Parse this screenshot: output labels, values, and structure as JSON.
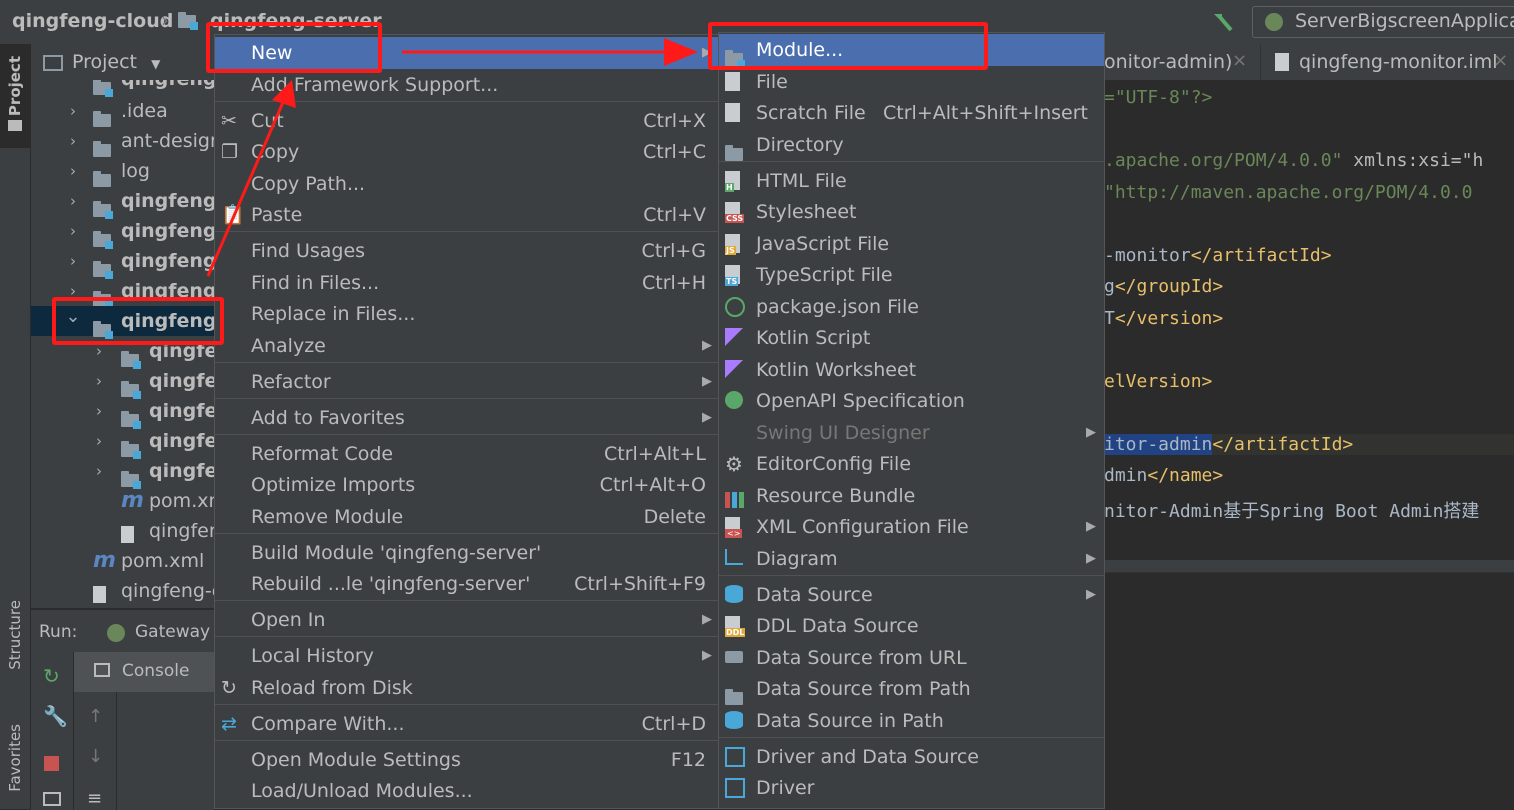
{
  "breadcrumb": {
    "project": "qingfeng-cloud",
    "module": "qingfeng-server"
  },
  "run_config": {
    "label": "ServerBigscreenApplicatio"
  },
  "side_tabs": {
    "project": "Project",
    "structure": "Structure",
    "favorites": "Favorites"
  },
  "project_panel": {
    "title": "Project"
  },
  "tree": {
    "items": [
      {
        "label": "qingfeng-clo",
        "kind": "module"
      },
      {
        "label": ".idea",
        "kind": "folder"
      },
      {
        "label": "ant-design",
        "kind": "folder"
      },
      {
        "label": "log",
        "kind": "folder"
      },
      {
        "label": "qingfeng-",
        "kind": "module"
      },
      {
        "label": "qingfeng-",
        "kind": "module"
      },
      {
        "label": "qingfeng-",
        "kind": "module"
      },
      {
        "label": "qingfeng-",
        "kind": "module"
      },
      {
        "label": "qingfeng-",
        "kind": "module"
      },
      {
        "label": "qingfen",
        "kind": "module"
      },
      {
        "label": "qingfen",
        "kind": "module"
      },
      {
        "label": "qingfen",
        "kind": "module"
      },
      {
        "label": "qingfen",
        "kind": "module"
      },
      {
        "label": "qingfen",
        "kind": "module"
      },
      {
        "label": "pom.xm",
        "kind": "maven"
      },
      {
        "label": "qingfen",
        "kind": "file"
      },
      {
        "label": "pom.xml",
        "kind": "maven"
      },
      {
        "label": "qingfeng-c",
        "kind": "file"
      }
    ]
  },
  "run_panel": {
    "label": "Run:",
    "config": "Gateway",
    "console_tab": "Console"
  },
  "editor_tabs": {
    "tab1": "onitor-admin)",
    "tab2": "qingfeng-monitor.iml"
  },
  "code_lines": [
    {
      "a": "=\"UTF-8\"?>",
      "b": "",
      "c": ""
    },
    {
      "a": ".apache.org/POM/4.0.0\"",
      "b": " xmlns:xsi=\"h",
      "c": ""
    },
    {
      "a": "\"http://maven.apache.org/POM/4.0.0",
      "b": "",
      "c": ""
    },
    {
      "a": "-monitor",
      "b": "</artifactId>",
      "c": ""
    },
    {
      "a": "g",
      "b": "</groupId>",
      "c": ""
    },
    {
      "a": "T",
      "b": "</version>",
      "c": ""
    },
    {
      "a": "elVersion>",
      "b": "",
      "c": ""
    },
    {
      "a": "itor-admin",
      "b": "</artifactId>",
      "c": ""
    },
    {
      "a": "dmin",
      "b": "</name>",
      "c": ""
    },
    {
      "a": "nitor-Admin基于Spring Boot Admin搭建",
      "b": "",
      "c": ""
    }
  ],
  "context_menu": {
    "items": [
      {
        "label": "New",
        "shortcut": "",
        "submenu": true,
        "highlight": true
      },
      {
        "label": "Add Framework Support...",
        "shortcut": "",
        "submenu": false
      },
      {
        "label": "Cut",
        "shortcut": "Ctrl+X",
        "submenu": false,
        "icon": "scissors-icon"
      },
      {
        "label": "Copy",
        "shortcut": "Ctrl+C",
        "submenu": false,
        "icon": "copy-icon"
      },
      {
        "label": "Copy Path...",
        "shortcut": "",
        "submenu": false
      },
      {
        "label": "Paste",
        "shortcut": "Ctrl+V",
        "submenu": false,
        "icon": "paste-icon"
      },
      {
        "label": "Find Usages",
        "shortcut": "Ctrl+G",
        "submenu": false
      },
      {
        "label": "Find in Files...",
        "shortcut": "Ctrl+H",
        "submenu": false
      },
      {
        "label": "Replace in Files...",
        "shortcut": "",
        "submenu": false
      },
      {
        "label": "Analyze",
        "shortcut": "",
        "submenu": true
      },
      {
        "label": "Refactor",
        "shortcut": "",
        "submenu": true
      },
      {
        "label": "Add to Favorites",
        "shortcut": "",
        "submenu": true
      },
      {
        "label": "Reformat Code",
        "shortcut": "Ctrl+Alt+L",
        "submenu": false
      },
      {
        "label": "Optimize Imports",
        "shortcut": "Ctrl+Alt+O",
        "submenu": false
      },
      {
        "label": "Remove Module",
        "shortcut": "Delete",
        "submenu": false
      },
      {
        "label": "Build Module 'qingfeng-server'",
        "shortcut": "",
        "submenu": false
      },
      {
        "label": "Rebuild ...le 'qingfeng-server'",
        "shortcut": "Ctrl+Shift+F9",
        "submenu": false
      },
      {
        "label": "Open In",
        "shortcut": "",
        "submenu": true
      },
      {
        "label": "Local History",
        "shortcut": "",
        "submenu": true
      },
      {
        "label": "Reload from Disk",
        "shortcut": "",
        "submenu": false,
        "icon": "reload-icon"
      },
      {
        "label": "Compare With...",
        "shortcut": "Ctrl+D",
        "submenu": false,
        "icon": "compare-icon"
      },
      {
        "label": "Open Module Settings",
        "shortcut": "F12",
        "submenu": false
      },
      {
        "label": "Load/Unload Modules...",
        "shortcut": "",
        "submenu": false
      }
    ]
  },
  "new_submenu": {
    "items": [
      {
        "label": "Module...",
        "submenu": false,
        "highlight": true,
        "icon": "module-icon"
      },
      {
        "label": "File",
        "submenu": false,
        "icon": "file-icon"
      },
      {
        "label": "Scratch File",
        "shortcut": "Ctrl+Alt+Shift+Insert",
        "submenu": false,
        "icon": "scratch-file-icon"
      },
      {
        "label": "Directory",
        "submenu": false,
        "icon": "folder-icon"
      },
      {
        "label": "HTML File",
        "submenu": false,
        "icon": "html-file-icon",
        "badge": "H"
      },
      {
        "label": "Stylesheet",
        "submenu": false,
        "icon": "css-file-icon",
        "badge": "CSS"
      },
      {
        "label": "JavaScript File",
        "submenu": false,
        "icon": "js-file-icon",
        "badge": "JS"
      },
      {
        "label": "TypeScript File",
        "submenu": false,
        "icon": "ts-file-icon",
        "badge": "TS"
      },
      {
        "label": "package.json File",
        "submenu": false,
        "icon": "nodejs-icon"
      },
      {
        "label": "Kotlin Script",
        "submenu": false,
        "icon": "kotlin-icon"
      },
      {
        "label": "Kotlin Worksheet",
        "submenu": false,
        "icon": "kotlin-icon"
      },
      {
        "label": "OpenAPI Specification",
        "submenu": false,
        "icon": "openapi-icon"
      },
      {
        "label": "Swing UI Designer",
        "submenu": true,
        "disabled": true
      },
      {
        "label": "EditorConfig File",
        "submenu": false,
        "icon": "gear-icon"
      },
      {
        "label": "Resource Bundle",
        "submenu": false,
        "icon": "resource-bundle-icon"
      },
      {
        "label": "XML Configuration File",
        "submenu": true,
        "icon": "xml-file-icon"
      },
      {
        "label": "Diagram",
        "submenu": true,
        "icon": "diagram-icon"
      },
      {
        "label": "Data Source",
        "submenu": true,
        "icon": "database-icon"
      },
      {
        "label": "DDL Data Source",
        "submenu": false,
        "icon": "ddl-icon",
        "badge": "DDL"
      },
      {
        "label": "Data Source from URL",
        "submenu": false,
        "icon": "url-datasource-icon"
      },
      {
        "label": "Data Source from Path",
        "submenu": false,
        "icon": "folder-open-icon"
      },
      {
        "label": "Data Source in Path",
        "submenu": false,
        "icon": "database-icon"
      },
      {
        "label": "Driver and Data Source",
        "submenu": false,
        "icon": "driver-icon"
      },
      {
        "label": "Driver",
        "submenu": false,
        "icon": "driver-icon"
      }
    ]
  },
  "colors": {
    "highlight": "#4b6eaf",
    "annotation": "#ff1a1a",
    "panel": "#3c3f41",
    "editor": "#2b2b2b"
  }
}
